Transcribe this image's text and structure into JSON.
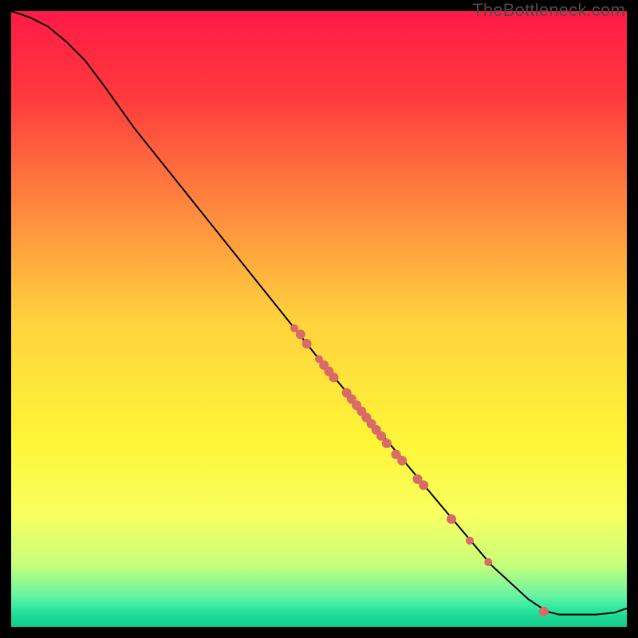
{
  "watermark": "TheBottleneck.com",
  "chart_data": {
    "type": "line",
    "title": "",
    "xlabel": "",
    "ylabel": "",
    "xlim": [
      0,
      100
    ],
    "ylim": [
      0,
      100
    ],
    "grid": false,
    "background_gradient": {
      "stops": [
        {
          "offset": 0.0,
          "color": "#ff1a47"
        },
        {
          "offset": 0.14,
          "color": "#ff3a3d"
        },
        {
          "offset": 0.3,
          "color": "#ff803e"
        },
        {
          "offset": 0.5,
          "color": "#ffd23d"
        },
        {
          "offset": 0.7,
          "color": "#fef637"
        },
        {
          "offset": 0.82,
          "color": "#f8ff61"
        },
        {
          "offset": 0.9,
          "color": "#c6ff7a"
        },
        {
          "offset": 0.95,
          "color": "#66f3a3"
        },
        {
          "offset": 0.97,
          "color": "#2fe8a0"
        },
        {
          "offset": 0.985,
          "color": "#1bd795"
        },
        {
          "offset": 1.0,
          "color": "#13cd8e"
        }
      ]
    },
    "curve": [
      {
        "x": 0,
        "y": 100.0
      },
      {
        "x": 3,
        "y": 99.0
      },
      {
        "x": 6,
        "y": 97.5
      },
      {
        "x": 9,
        "y": 95.0
      },
      {
        "x": 12,
        "y": 92.0
      },
      {
        "x": 15,
        "y": 88.0
      },
      {
        "x": 20,
        "y": 81.0
      },
      {
        "x": 30,
        "y": 68.5
      },
      {
        "x": 40,
        "y": 56.0
      },
      {
        "x": 50,
        "y": 43.5
      },
      {
        "x": 60,
        "y": 31.5
      },
      {
        "x": 70,
        "y": 19.5
      },
      {
        "x": 78,
        "y": 10.0
      },
      {
        "x": 84,
        "y": 4.5
      },
      {
        "x": 87,
        "y": 2.5
      },
      {
        "x": 89,
        "y": 2.0
      },
      {
        "x": 95,
        "y": 2.0
      },
      {
        "x": 98,
        "y": 2.3
      },
      {
        "x": 100,
        "y": 3.0
      }
    ],
    "points": [
      {
        "x": 46.0,
        "y": 48.5,
        "r": 5
      },
      {
        "x": 47.0,
        "y": 47.5,
        "r": 6
      },
      {
        "x": 48.0,
        "y": 46.0,
        "r": 6
      },
      {
        "x": 50.0,
        "y": 43.5,
        "r": 5
      },
      {
        "x": 50.8,
        "y": 42.5,
        "r": 6
      },
      {
        "x": 51.6,
        "y": 41.5,
        "r": 6
      },
      {
        "x": 52.4,
        "y": 40.5,
        "r": 6
      },
      {
        "x": 54.5,
        "y": 38.0,
        "r": 6
      },
      {
        "x": 55.3,
        "y": 37.0,
        "r": 6
      },
      {
        "x": 56.1,
        "y": 36.0,
        "r": 6
      },
      {
        "x": 56.9,
        "y": 35.0,
        "r": 6
      },
      {
        "x": 57.7,
        "y": 34.0,
        "r": 6
      },
      {
        "x": 58.5,
        "y": 33.0,
        "r": 6
      },
      {
        "x": 59.3,
        "y": 32.0,
        "r": 6
      },
      {
        "x": 60.1,
        "y": 31.0,
        "r": 6
      },
      {
        "x": 61.0,
        "y": 29.8,
        "r": 6
      },
      {
        "x": 62.5,
        "y": 28.0,
        "r": 6
      },
      {
        "x": 63.5,
        "y": 27.0,
        "r": 6
      },
      {
        "x": 66.0,
        "y": 24.0,
        "r": 6
      },
      {
        "x": 67.0,
        "y": 23.0,
        "r": 6
      },
      {
        "x": 71.5,
        "y": 17.5,
        "r": 6
      },
      {
        "x": 74.5,
        "y": 14.0,
        "r": 5
      },
      {
        "x": 77.5,
        "y": 10.5,
        "r": 5
      },
      {
        "x": 86.5,
        "y": 2.5,
        "r": 6
      }
    ],
    "colors": {
      "curve": "#000000",
      "points": "#d96a65"
    }
  }
}
